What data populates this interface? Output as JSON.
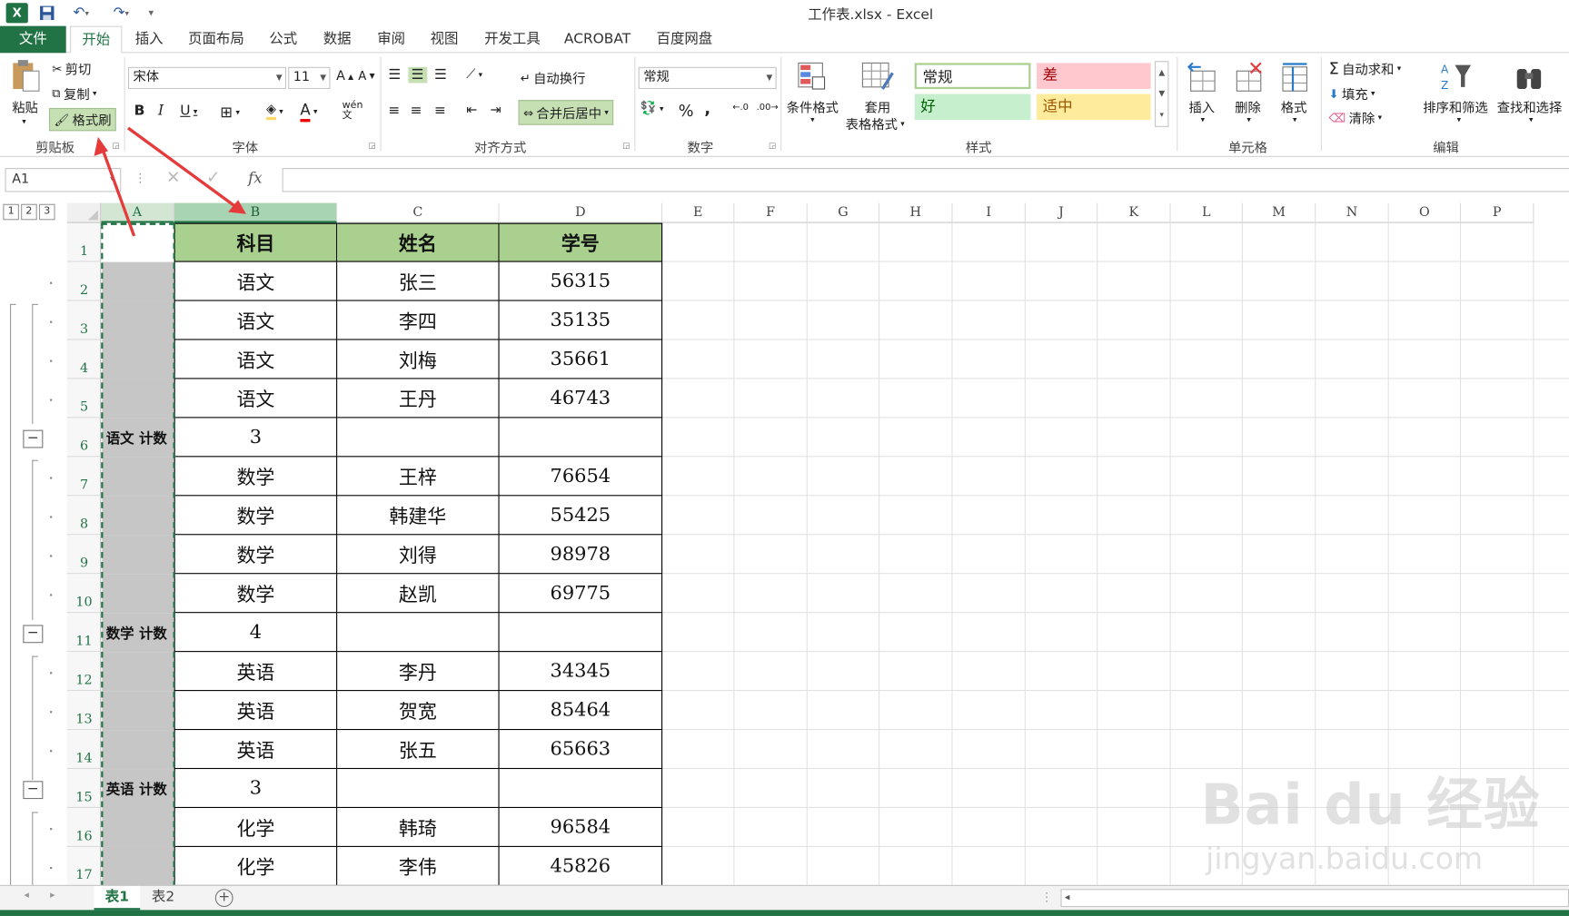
{
  "window": {
    "title": "工作表.xlsx - Excel"
  },
  "tabs": [
    "文件",
    "开始",
    "插入",
    "页面布局",
    "公式",
    "数据",
    "审阅",
    "视图",
    "开发工具",
    "ACROBAT",
    "百度网盘"
  ],
  "ribbon": {
    "clipboard": {
      "paste": "粘贴",
      "cut": "剪切",
      "copy": "复制",
      "format_painter": "格式刷",
      "label": "剪贴板"
    },
    "font": {
      "name": "宋体",
      "size": "11",
      "label": "字体"
    },
    "alignment": {
      "wrap": "自动换行",
      "merge": "合并后居中",
      "label": "对齐方式"
    },
    "number": {
      "format": "常规",
      "label": "数字"
    },
    "styles": {
      "cond": "条件格式",
      "table1": "套用",
      "table2": "表格格式",
      "normal": "常规",
      "bad": "差",
      "good": "好",
      "neutral": "适中",
      "label": "样式"
    },
    "cells": {
      "insert": "插入",
      "delete": "删除",
      "format": "格式",
      "label": "单元格"
    },
    "editing": {
      "autosum": "自动求和",
      "fill": "填充",
      "clear": "清除",
      "sort": "排序和筛选",
      "find": "查找和选择",
      "label": "编辑"
    }
  },
  "formula_bar": {
    "name_box": "A1",
    "fx": "fx",
    "value": ""
  },
  "outline_levels": [
    "1",
    "2",
    "3"
  ],
  "columns": [
    "A",
    "B",
    "C",
    "D",
    "E",
    "F",
    "G",
    "H",
    "I",
    "J",
    "K",
    "L",
    "M",
    "N",
    "O",
    "P"
  ],
  "table": {
    "headers": [
      "科目",
      "姓名",
      "学号"
    ],
    "rows": [
      {
        "row": "1",
        "a": "",
        "b": "",
        "c": "",
        "d": ""
      },
      {
        "row": "2",
        "a": "",
        "b": "语文",
        "c": "张三",
        "d": "56315"
      },
      {
        "row": "3",
        "a": "",
        "b": "语文",
        "c": "李四",
        "d": "35135"
      },
      {
        "row": "4",
        "a": "",
        "b": "语文",
        "c": "刘梅",
        "d": "35661"
      },
      {
        "row": "5",
        "a": "",
        "b": "语文",
        "c": "王丹",
        "d": "46743"
      },
      {
        "row": "6",
        "a": "语文 计数",
        "b": "3",
        "c": "",
        "d": ""
      },
      {
        "row": "7",
        "a": "",
        "b": "数学",
        "c": "王梓",
        "d": "76654"
      },
      {
        "row": "8",
        "a": "",
        "b": "数学",
        "c": "韩建华",
        "d": "55425"
      },
      {
        "row": "9",
        "a": "",
        "b": "数学",
        "c": "刘得",
        "d": "98978"
      },
      {
        "row": "10",
        "a": "",
        "b": "数学",
        "c": "赵凯",
        "d": "69775"
      },
      {
        "row": "11",
        "a": "数学 计数",
        "b": "4",
        "c": "",
        "d": ""
      },
      {
        "row": "12",
        "a": "",
        "b": "英语",
        "c": "李丹",
        "d": "34345"
      },
      {
        "row": "13",
        "a": "",
        "b": "英语",
        "c": "贺宽",
        "d": "85464"
      },
      {
        "row": "14",
        "a": "",
        "b": "英语",
        "c": "张五",
        "d": "65663"
      },
      {
        "row": "15",
        "a": "英语 计数",
        "b": "3",
        "c": "",
        "d": ""
      },
      {
        "row": "16",
        "a": "",
        "b": "化学",
        "c": "韩琦",
        "d": "96584"
      },
      {
        "row": "17",
        "a": "",
        "b": "化学",
        "c": "李伟",
        "d": "45826"
      }
    ]
  },
  "sheets": [
    "表1",
    "表2"
  ],
  "watermark": {
    "line1": "Bai du 经验",
    "line2": "jingyan.baidu.com"
  }
}
